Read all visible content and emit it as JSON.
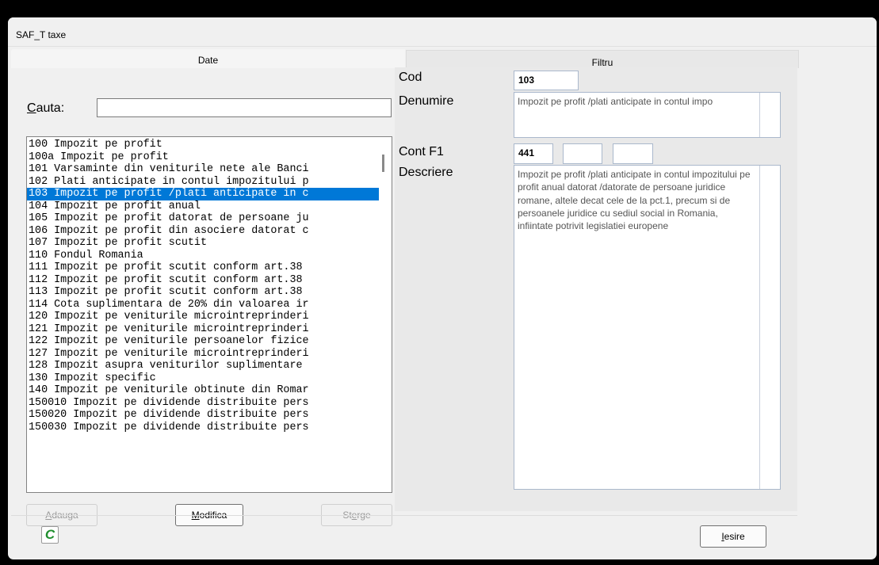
{
  "window": {
    "title": "SAF_T taxe"
  },
  "tabs": {
    "date": "Date",
    "filtru": "Filtru"
  },
  "search": {
    "label_underlined": "C",
    "label_rest": "auta:",
    "value": ""
  },
  "list": {
    "selected_index": 4,
    "items": [
      "100 Impozit pe profit",
      "100a Impozit pe profit",
      "101 Varsaminte din veniturile nete ale Banci",
      "102 Plati anticipate in contul impozitului p",
      "103 Impozit pe profit /plati anticipate in c",
      "104 Impozit pe profit anual",
      "105 Impozit pe profit datorat de persoane ju",
      "106 Impozit pe profit din asociere datorat c",
      "107 Impozit pe profit scutit",
      "110 Fondul Romania",
      "111 Impozit pe profit scutit conform art.38",
      "112 Impozit pe profit scutit conform art.38",
      "113 Impozit pe profit scutit conform art.38",
      "114 Cota suplimentara de 20% din valoarea ir",
      "120 Impozit pe veniturile microintreprinderi",
      "121 Impozit pe veniturile microintreprinderi",
      "122 Impozit pe veniturile persoanelor fizice",
      "127 Impozit pe veniturile microintreprinderi",
      "128 Impozit asupra veniturilor suplimentare",
      "130 Impozit specific",
      "140 Impozit pe veniturile obtinute din Romar",
      "150010 Impozit pe dividende distribuite pers",
      "150020 Impozit pe dividende distribuite pers",
      "150030 Impozit pe dividende distribuite pers"
    ]
  },
  "buttons": {
    "adauga": {
      "u": "A",
      "rest": "dauga"
    },
    "modifica": {
      "u": "M",
      "rest": "odifica"
    },
    "sterge_pre": "St",
    "sterge_u": "e",
    "sterge_post": "rge",
    "iesire": {
      "u": "I",
      "rest": "esire"
    }
  },
  "details": {
    "cod_label": "Cod",
    "cod_value": "103",
    "denumire_label": "Denumire",
    "denumire_value": "Impozit pe profit /plati anticipate in contul impo",
    "cont_label": "Cont F1",
    "cont_value": "441",
    "cont_value_2": "",
    "cont_value_3": "",
    "descriere_label": "Descriere",
    "descriere_value": "Impozit pe profit /plati anticipate in contul impozitului pe profit anual datorat /datorate de persoane juridice romane, altele decat cele de la pct.1, precum si de persoanele juridice cu sediul social in Romania, infiintate potrivit legislatiei europene"
  },
  "icons": {
    "app_icon": "c-green-app-icon"
  },
  "colors": {
    "selection": "#0078d7",
    "icon_green": "#1f8e2e"
  }
}
